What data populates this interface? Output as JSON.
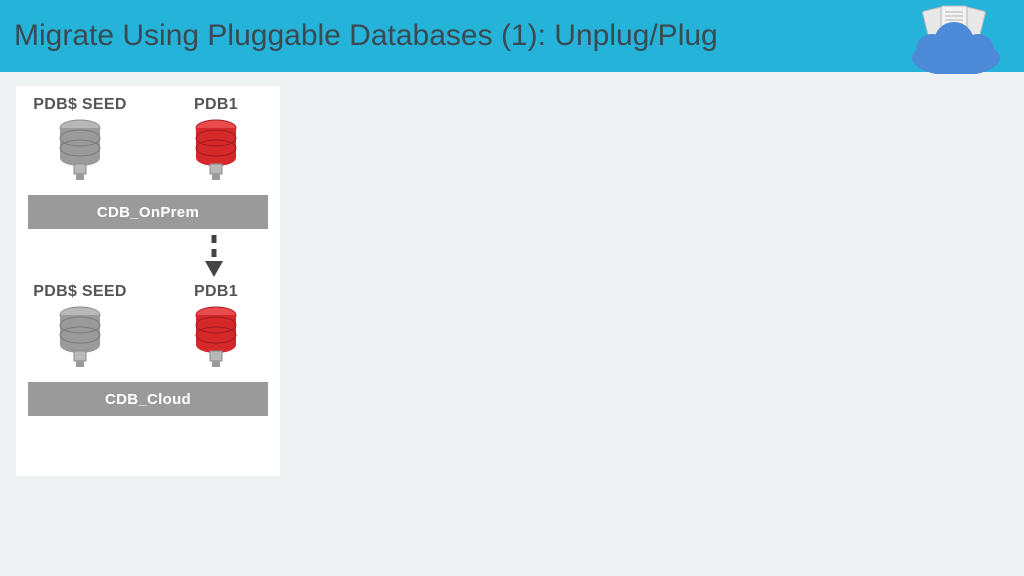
{
  "header": {
    "title": "Migrate Using Pluggable Databases (1): Unplug/Plug"
  },
  "diagram": {
    "top_block": {
      "pdb_seed_label": "PDB$ SEED",
      "pdb1_label": "PDB1",
      "cdb_label": "CDB_OnPrem"
    },
    "bottom_block": {
      "pdb_seed_label": "PDB$ SEED",
      "pdb1_label": "PDB1",
      "cdb_label": "CDB_Cloud"
    }
  },
  "colors": {
    "header_bg": "#26b3da",
    "db_gray": "#9a9a9a",
    "db_red": "#d4282b",
    "cloud": "#4c89d6"
  }
}
